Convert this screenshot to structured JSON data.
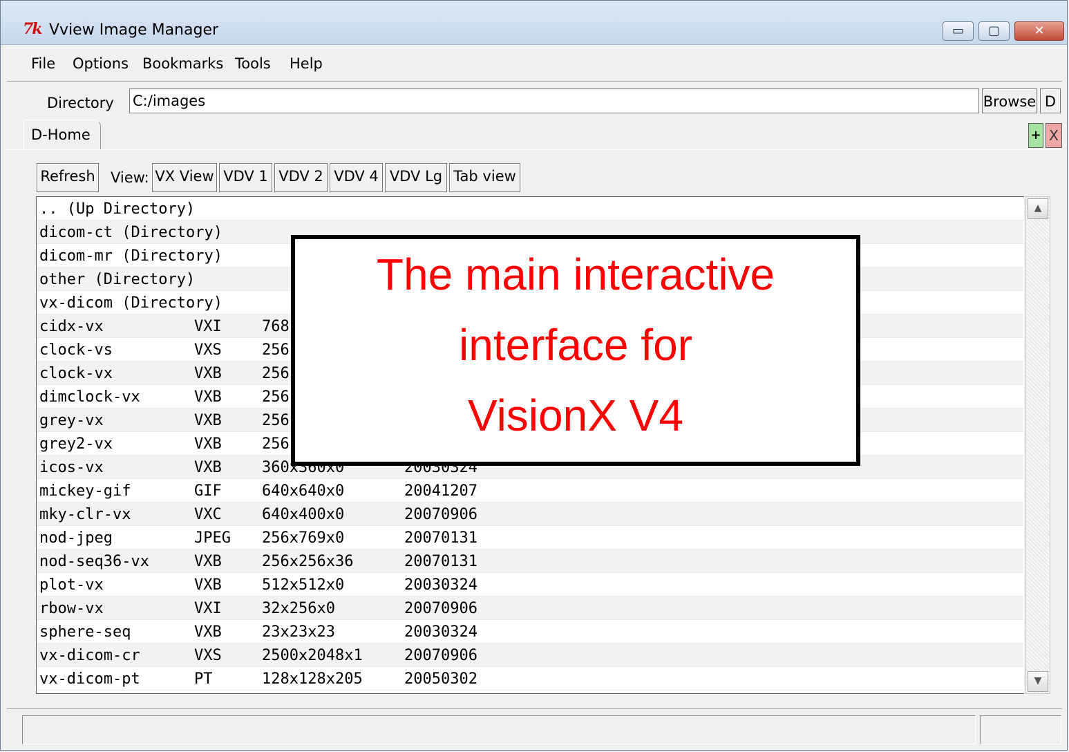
{
  "window": {
    "logo": "7k",
    "title": "Vview Image Manager",
    "controls": {
      "minimize": "▭",
      "maximize": "▢",
      "close": "✕"
    }
  },
  "menu": [
    "File",
    "Options",
    "Bookmarks",
    "Tools",
    "Help"
  ],
  "directory": {
    "label": "Directory",
    "value": "C:/images",
    "browse_label": "Browse",
    "d_label": "D"
  },
  "tabs": {
    "active": "D-Home",
    "add_label": "+",
    "close_label": "X"
  },
  "toolbar": {
    "refresh_label": "Refresh",
    "view_label": "View:",
    "views": [
      "VX View",
      "VDV 1",
      "VDV 2",
      "VDV 4",
      "VDV Lg",
      "Tab view"
    ]
  },
  "listing": [
    [
      "..",
      "(Up Directory)",
      "",
      ""
    ],
    [
      "dicom-ct",
      "(Directory)",
      "",
      ""
    ],
    [
      "dicom-mr",
      "(Directory)",
      "",
      ""
    ],
    [
      "other",
      "(Directory)",
      "",
      ""
    ],
    [
      "vx-dicom",
      "(Directory)",
      "",
      ""
    ],
    [
      "cidx-vx",
      "VXI",
      "768",
      ""
    ],
    [
      "clock-vs",
      "VXS",
      "256",
      ""
    ],
    [
      "clock-vx",
      "VXB",
      "256",
      ""
    ],
    [
      "dimclock-vx",
      "VXB",
      "256",
      ""
    ],
    [
      "grey-vx",
      "VXB",
      "256",
      ""
    ],
    [
      "grey2-vx",
      "VXB",
      "256",
      ""
    ],
    [
      "icos-vx",
      "VXB",
      "360x360x0",
      "20030324"
    ],
    [
      "mickey-gif",
      "GIF",
      "640x640x0",
      "20041207"
    ],
    [
      "mky-clr-vx",
      "VXC",
      "640x400x0",
      "20070906"
    ],
    [
      "nod-jpeg",
      "JPEG",
      "256x769x0",
      "20070131"
    ],
    [
      "nod-seq36-vx",
      "VXB",
      "256x256x36",
      "20070131"
    ],
    [
      "plot-vx",
      "VXB",
      "512x512x0",
      "20030324"
    ],
    [
      "rbow-vx",
      "VXI",
      "32x256x0",
      "20070906"
    ],
    [
      "sphere-seq",
      "VXB",
      "23x23x23",
      "20030324"
    ],
    [
      "vx-dicom-cr",
      "VXS",
      "2500x2048x1",
      "20070906"
    ],
    [
      "vx-dicom-pt",
      "PT",
      "128x128x205",
      "20050302"
    ]
  ],
  "scrollbar": {
    "up": "▲",
    "down": "▼"
  },
  "caption": {
    "lines": [
      "The main interactive",
      "interface for",
      "VisionX V4"
    ],
    "color": "#ff0000"
  }
}
